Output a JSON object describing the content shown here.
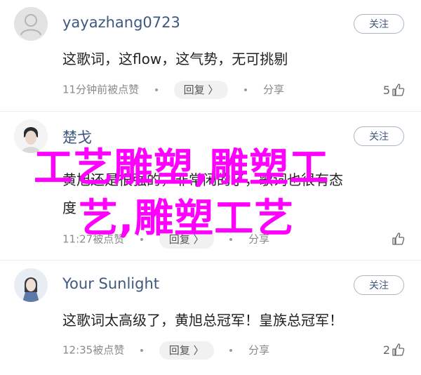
{
  "comments": [
    {
      "username": "yayazhang0723",
      "follow_label": "关注",
      "content": "这歌词，这flow，这气势，无可挑剔",
      "time": "11分钟前被点赞",
      "reply_label": "回复 〉",
      "share_label": "分享",
      "likes": "5"
    },
    {
      "username": "楚戈",
      "follow_label": "关注",
      "content_line1": "黄旭还是很强的，非常闲的了，歌词也很有态",
      "content_line2": "度",
      "time": "11:27被点赞",
      "reply_label": "回复 〉",
      "share_label": "分享",
      "likes": ""
    },
    {
      "username": "Your Sunlight",
      "follow_label": "关注",
      "content": "这歌词太高级了，黄旭总冠军！皇族总冠军！",
      "time": "12:35被点赞",
      "reply_label": "回复 〉",
      "share_label": "分享",
      "likes": "2"
    }
  ],
  "overlay": {
    "line1": "工艺雕塑,雕塑工",
    "line2": "艺,雕塑工艺"
  },
  "colors": {
    "overlay": "#ff00ff",
    "username": "#3f587f"
  }
}
